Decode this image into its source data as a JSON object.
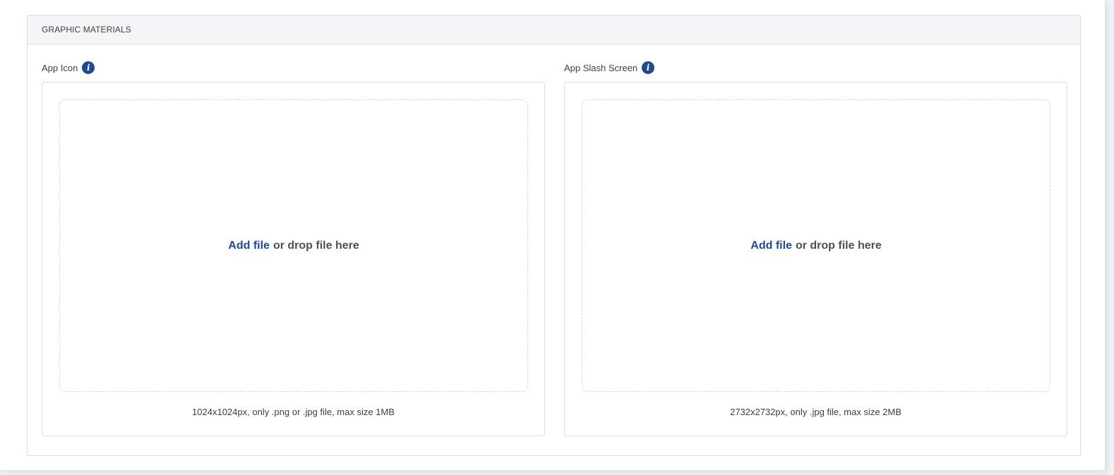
{
  "section": {
    "title": "GRAPHIC MATERIALS"
  },
  "fields": [
    {
      "label": "App Icon",
      "info_icon": "i",
      "add_file_label": "Add file",
      "drop_text": "or drop file here",
      "hint": "1024x1024px, only .png or .jpg file, max size 1MB"
    },
    {
      "label": "App Slash Screen",
      "info_icon": "i",
      "add_file_label": "Add file",
      "drop_text": "or drop file here",
      "hint": "2732x2732px, only .jpg file, max size 2MB"
    }
  ],
  "colors": {
    "accent": "#1f4b8e",
    "text": "#3a4149",
    "border": "#d9dde2",
    "header_bg": "#f4f5f7"
  }
}
